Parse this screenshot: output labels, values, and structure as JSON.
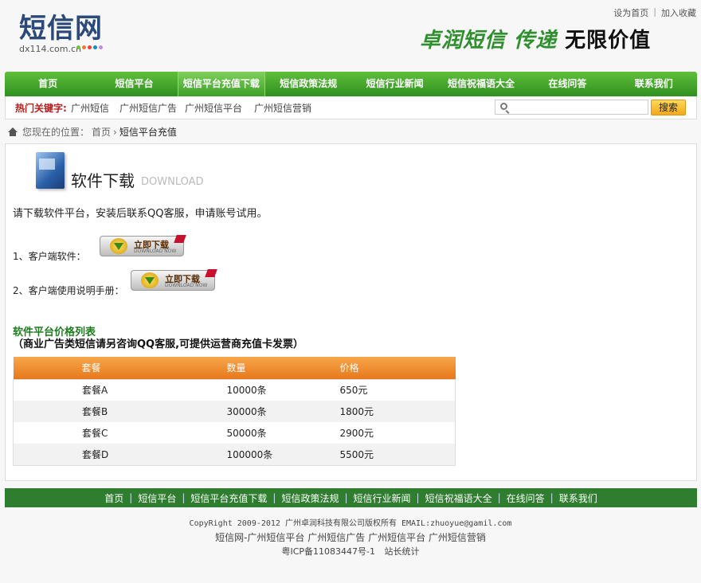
{
  "top_links": [
    "设为首页",
    "加入收藏"
  ],
  "logo": {
    "title": "短信网",
    "domain": "dx114.com.cn"
  },
  "slogan": {
    "part1": "卓润短信",
    "part2": "传递",
    "part3": "无限价值"
  },
  "nav": [
    "首页",
    "短信平台",
    "短信平台充值下载",
    "短信政策法规",
    "短信行业新闻",
    "短信祝福语大全",
    "在线问答",
    "联系我们"
  ],
  "nav_active_index": 2,
  "hot": {
    "label": "热门关键字:",
    "keywords": [
      "广州短信",
      "广州短信广告",
      "广州短信平台",
      "广州短信营销"
    ]
  },
  "search": {
    "placeholder": "",
    "button": "搜索"
  },
  "breadcrumb": {
    "prefix": "您现在的位置：",
    "home": "首页",
    "current": "短信平台充值"
  },
  "section": {
    "title": "软件下载",
    "title_en": "DOWNLOAD",
    "intro": "请下载软件平台，安装后联系QQ客服，申请账号试用。"
  },
  "downloads": [
    {
      "label": "1、客户端软件：",
      "button": "立即下载",
      "button_sub": "DOWNLOAD NOW"
    },
    {
      "label": "2、客户端使用说明手册：",
      "button": "立即下载",
      "button_sub": "DOWNLOAD NOW"
    }
  ],
  "price": {
    "title": "软件平台价格列表",
    "note": "（商业广告类短信请另咨询QQ客服,可提供运营商充值卡发票）",
    "headers": [
      "套餐",
      "数量",
      "价格"
    ],
    "rows": [
      [
        "套餐A",
        "10000条",
        "650元"
      ],
      [
        "套餐B",
        "30000条",
        "1800元"
      ],
      [
        "套餐C",
        "50000条",
        "2900元"
      ],
      [
        "套餐D",
        "100000条",
        "5500元"
      ]
    ]
  },
  "footer": {
    "nav": [
      "首页",
      "短信平台",
      "短信平台充值下载",
      "短信政策法规",
      "短信行业新闻",
      "短信祝福语大全",
      "在线问答",
      "联系我们"
    ],
    "copyright": "CopyRight 2009-2012 广州卓润科技有限公司版权所有 EMAIL:zhuoyue@gamil.com",
    "links": [
      "短信网-广州短信平台",
      "广州短信广告",
      "广州短信平台",
      "广州短信营销"
    ],
    "icp": "粤ICP备11083447号-1",
    "stats": "站长统计"
  }
}
